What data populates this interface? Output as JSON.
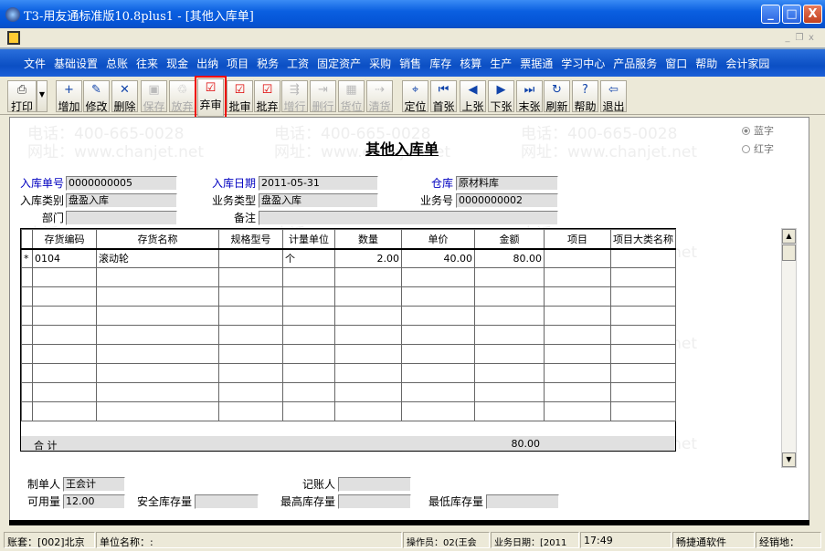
{
  "window": {
    "title": "T3-用友通标准版10.8plus1 - [其他入库单]",
    "minimize": "_",
    "maximize": "□",
    "close": "X"
  },
  "mdi": {
    "minimize": "_",
    "restore": "❐",
    "close": "x"
  },
  "menu": [
    "文件",
    "基础设置",
    "总账",
    "往来",
    "现金",
    "出纳",
    "项目",
    "税务",
    "工资",
    "固定资产",
    "采购",
    "销售",
    "库存",
    "核算",
    "生产",
    "票据通",
    "学习中心",
    "产品服务",
    "窗口",
    "帮助",
    "会计家园"
  ],
  "toolbar": {
    "print": "打印",
    "buttons": [
      {
        "label": "增加",
        "icon": "+",
        "enabled": true
      },
      {
        "label": "修改",
        "icon": "✎",
        "enabled": true
      },
      {
        "label": "删除",
        "icon": "✕",
        "enabled": true
      },
      {
        "label": "保存",
        "icon": "▣",
        "enabled": false
      },
      {
        "label": "放弃",
        "icon": "♲",
        "enabled": false
      },
      {
        "label": "弃审",
        "icon": "☑",
        "enabled": true,
        "highlighted": true
      },
      {
        "label": "批审",
        "icon": "☑",
        "enabled": true
      },
      {
        "label": "批弃",
        "icon": "☑",
        "enabled": true
      },
      {
        "label": "增行",
        "icon": "⇶",
        "enabled": false
      },
      {
        "label": "删行",
        "icon": "⇥",
        "enabled": false
      },
      {
        "label": "货位",
        "icon": "▦",
        "enabled": false
      },
      {
        "label": "清货",
        "icon": "⇢",
        "enabled": false
      },
      {
        "label": "定位",
        "icon": "⌖",
        "enabled": true
      },
      {
        "label": "首张",
        "icon": "⏮",
        "enabled": true
      },
      {
        "label": "上张",
        "icon": "◀",
        "enabled": true
      },
      {
        "label": "下张",
        "icon": "▶",
        "enabled": true
      },
      {
        "label": "末张",
        "icon": "⏭",
        "enabled": true
      },
      {
        "label": "刷新",
        "icon": "↻",
        "enabled": true
      },
      {
        "label": "帮助",
        "icon": "?",
        "enabled": true
      },
      {
        "label": "退出",
        "icon": "⇦",
        "enabled": true
      }
    ]
  },
  "watermark": {
    "phone": "电话：400-665-0028",
    "site": "网址：www.chanjet.net"
  },
  "doc": {
    "title": "其他入库单",
    "radio_blue": "蓝字",
    "radio_red": "红字",
    "fields": {
      "no_label": "入库单号",
      "no": "0000000005",
      "date_label": "入库日期",
      "date": "2011-05-31",
      "wh_label": "仓库",
      "wh": "原材料库",
      "type_label": "入库类别",
      "type": "盘盈入库",
      "biz_type_label": "业务类型",
      "biz_type": "盘盈入库",
      "biz_no_label": "业务号",
      "biz_no": "0000000002",
      "dept_label": "部门",
      "dept": "",
      "note_label": "备注",
      "note": ""
    }
  },
  "grid": {
    "columns": [
      "存货编码",
      "存货名称",
      "规格型号",
      "计量单位",
      "数量",
      "单价",
      "金额",
      "项目",
      "项目大类名称"
    ],
    "rows": [
      {
        "marker": "*",
        "code": "0104",
        "name": "滚动轮",
        "spec": "",
        "unit": "个",
        "qty": "2.00",
        "price": "40.00",
        "amount": "80.00",
        "project": "",
        "project_class": ""
      }
    ],
    "total_label": "合  计",
    "total_amount": "80.00"
  },
  "footer": {
    "maker_label": "制单人",
    "maker": "王会计",
    "bookkeeper_label": "记账人",
    "bookkeeper": "",
    "avail_label": "可用量",
    "avail": "12.00",
    "safe_label": "安全库存量",
    "safe": "",
    "max_label": "最高库存量",
    "max": "",
    "min_label": "最低库存量",
    "min": ""
  },
  "status": [
    "账套：[002]北京",
    "单位名称：:",
    "操作员：02(王会",
    "业务日期：[2011",
    "17:49",
    "畅捷通软件",
    "经销地："
  ]
}
